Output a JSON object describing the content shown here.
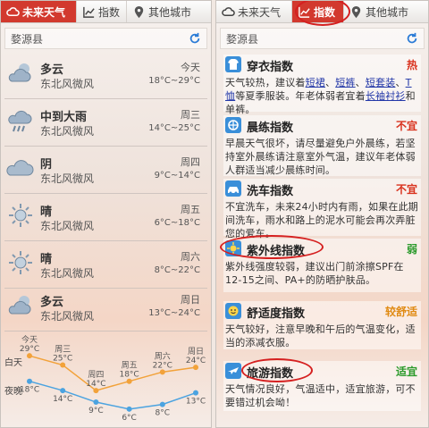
{
  "left": {
    "tabs": [
      {
        "label": "未来天气",
        "icon": "cloud-icon",
        "active": true
      },
      {
        "label": "指数",
        "icon": "chart-icon",
        "active": false
      },
      {
        "label": "其他城市",
        "icon": "map-pin-icon",
        "active": false
      }
    ],
    "city": "婺源县",
    "days": [
      {
        "condition": "多云",
        "wind": "东北风微风",
        "day": "今天",
        "temp": "18°C~29°C",
        "icon": "partly-cloudy-icon"
      },
      {
        "condition": "中到大雨",
        "wind": "东北风微风",
        "day": "周三",
        "temp": "14°C~25°C",
        "icon": "heavy-rain-icon"
      },
      {
        "condition": "阴",
        "wind": "东北风微风",
        "day": "周四",
        "temp": "9°C~14°C",
        "icon": "overcast-icon"
      },
      {
        "condition": "晴",
        "wind": "东北风微风",
        "day": "周五",
        "temp": "6°C~18°C",
        "icon": "sun-icon"
      },
      {
        "condition": "晴",
        "wind": "东北风微风",
        "day": "周六",
        "temp": "8°C~22°C",
        "icon": "sun-icon"
      },
      {
        "condition": "多云",
        "wind": "东北风微风",
        "day": "周日",
        "temp": "13°C~24°C",
        "icon": "partly-cloudy-icon"
      }
    ],
    "chart": {
      "day_label": "白天",
      "night_label": "夜晚",
      "colors": {
        "day": "#f2a23a",
        "night": "#4ba3e0"
      }
    }
  },
  "right": {
    "tabs": [
      {
        "label": "未来天气",
        "icon": "cloud-icon",
        "active": false
      },
      {
        "label": "指数",
        "icon": "chart-icon",
        "active": true
      },
      {
        "label": "其他城市",
        "icon": "map-pin-icon",
        "active": false
      }
    ],
    "city": "婺源县",
    "indices": [
      {
        "title": "穿衣指数",
        "level": "热",
        "level_color": "#d9331f",
        "icon": "shirt-icon",
        "desc_parts": [
          {
            "text": "天气较热，建议着",
            "link": false
          },
          {
            "text": "短裙",
            "link": true
          },
          {
            "text": "、",
            "link": false
          },
          {
            "text": "短裤",
            "link": true
          },
          {
            "text": "、",
            "link": false
          },
          {
            "text": "短套装",
            "link": true
          },
          {
            "text": "、",
            "link": false
          },
          {
            "text": "T恤",
            "link": true
          },
          {
            "text": "等夏季服装。年老体弱者宜着",
            "link": false
          },
          {
            "text": "长袖衬衫",
            "link": true
          },
          {
            "text": "和单裤。",
            "link": false
          }
        ]
      },
      {
        "title": "晨练指数",
        "level": "不宜",
        "level_color": "#d9331f",
        "icon": "exercise-icon",
        "desc": "早晨天气很坏，请尽量避免户外晨练，若坚持室外晨练请注意室外气温，建议年老体弱人群适当减少晨练时间。"
      },
      {
        "title": "洗车指数",
        "level": "不宜",
        "level_color": "#d9331f",
        "icon": "car-wash-icon",
        "desc": "不宜洗车，未来24小时内有雨，如果在此期间洗车，雨水和路上的泥水可能会再次弄脏您的爱车。"
      },
      {
        "title": "紫外线指数",
        "level": "弱",
        "level_color": "#2b9a2b",
        "icon": "uv-icon",
        "desc": "紫外线强度较弱，建议出门前涂擦SPF在12-15之间、PA+的防晒护肤品。"
      },
      {
        "title": "舒适度指数",
        "level": "较舒适",
        "level_color": "#e08a12",
        "icon": "comfort-icon",
        "desc": "天气较好，注意早晚和午后的气温变化，适当的添减衣服。"
      },
      {
        "title": "旅游指数",
        "level": "适宜",
        "level_color": "#2b9a2b",
        "icon": "plane-icon",
        "desc": "天气情况良好，气温适中，适宜旅游，可不要错过机会呦！"
      }
    ]
  },
  "chart_data": {
    "type": "line",
    "categories": [
      "今天",
      "周三",
      "周四",
      "周五",
      "周六",
      "周日"
    ],
    "series": [
      {
        "name": "白天",
        "values": [
          29,
          25,
          14,
          18,
          22,
          24
        ]
      },
      {
        "name": "夜晚",
        "values": [
          18,
          14,
          9,
          6,
          8,
          13
        ]
      }
    ],
    "unit": "°C"
  }
}
